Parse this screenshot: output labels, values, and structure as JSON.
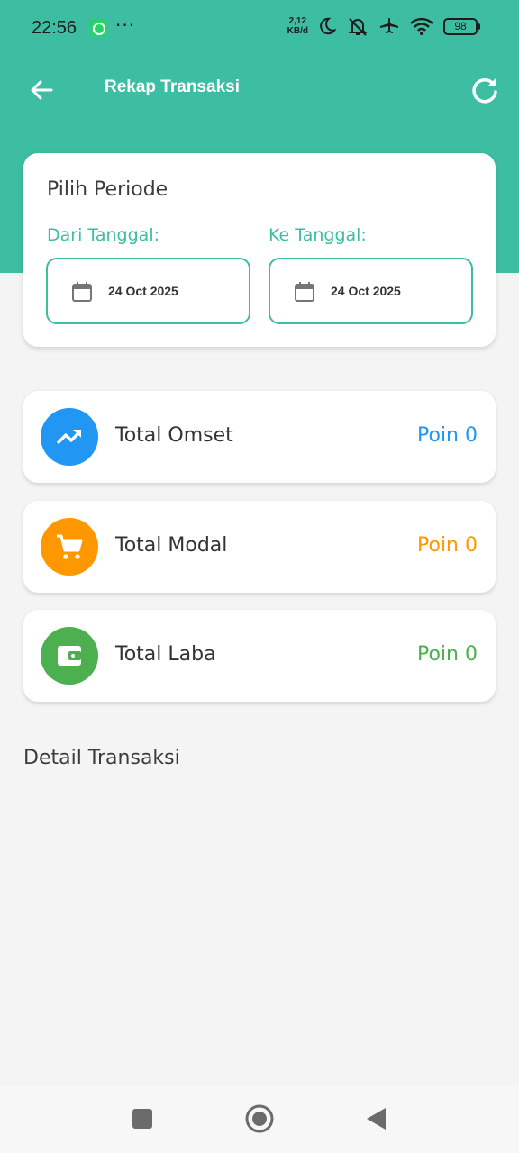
{
  "statusbar": {
    "time": "22:56",
    "more": "···",
    "net_speed_value": "2,12",
    "net_speed_unit": "KB/d",
    "battery": "98"
  },
  "appbar": {
    "title": "Rekap Transaksi",
    "back_icon": "arrow-left-icon",
    "refresh_icon": "refresh-icon"
  },
  "period": {
    "title": "Pilih Periode",
    "from_label": "Dari Tanggal:",
    "to_label": "Ke Tanggal:",
    "from_value": "24 Oct 2025",
    "to_value": "24 Oct 2025"
  },
  "summary": [
    {
      "label": "Total Omset",
      "value": "Poin 0",
      "icon": "trending-up-icon",
      "color": "#2196f3"
    },
    {
      "label": "Total Modal",
      "value": "Poin 0",
      "icon": "cart-icon",
      "color": "#ff9800"
    },
    {
      "label": "Total Laba",
      "value": "Poin 0",
      "icon": "wallet-icon",
      "color": "#4caf50"
    }
  ],
  "detail_title": "Detail Transaksi",
  "colors": {
    "primary": "#3dbda1",
    "background": "#f4f4f4"
  }
}
